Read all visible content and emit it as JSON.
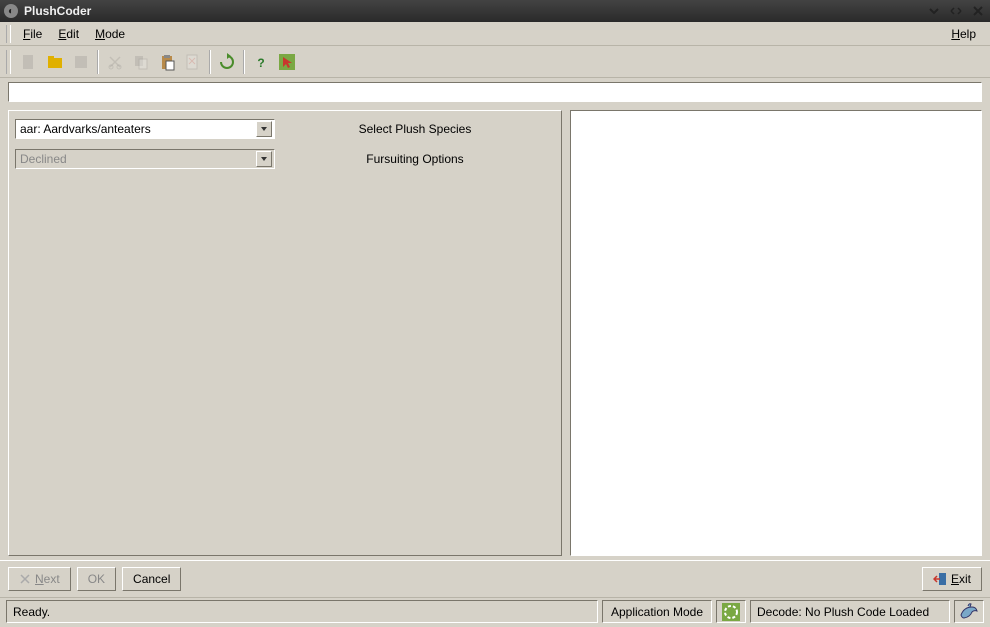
{
  "window": {
    "title": "PlushCoder"
  },
  "menu": {
    "file": "File",
    "edit": "Edit",
    "mode": "Mode",
    "help": "Help"
  },
  "toolbar": {
    "items": [
      "new",
      "open",
      "save",
      "cut",
      "copy",
      "paste",
      "clear",
      "reload",
      "help",
      "pointer"
    ]
  },
  "codefield": {
    "value": ""
  },
  "left": {
    "species_combo": "aar: Aardvarks/anteaters",
    "species_label": "Select Plush Species",
    "fursuit_combo": "Declined",
    "fursuit_label": "Fursuiting Options"
  },
  "actions": {
    "next": "Next",
    "ok": "OK",
    "cancel": "Cancel",
    "exit": "Exit"
  },
  "status": {
    "ready": "Ready.",
    "appmode": "Application Mode",
    "decode": "Decode: No Plush Code Loaded"
  }
}
